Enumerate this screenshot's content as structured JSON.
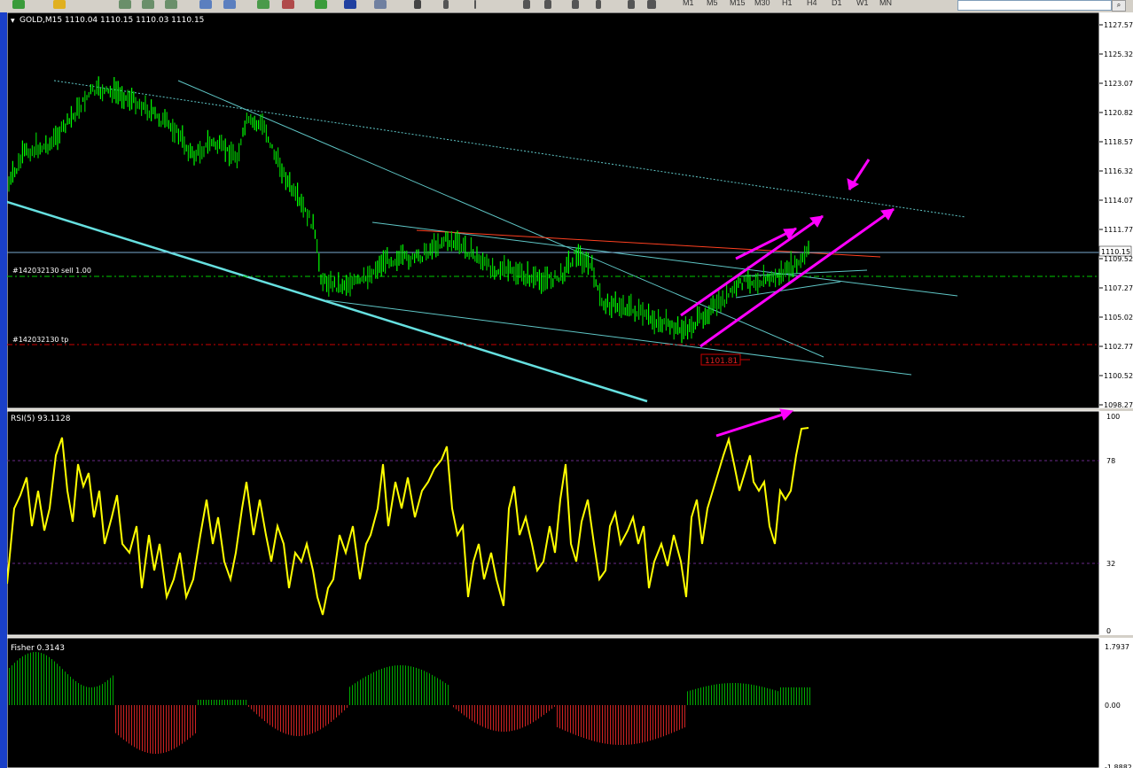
{
  "toolbar": {
    "timeframes": [
      "M1",
      "M5",
      "M15",
      "M30",
      "H1",
      "H4",
      "D1",
      "W1",
      "MN"
    ],
    "active_timeframe": "M15"
  },
  "price_chart": {
    "header": "GOLD,M15  1110.04 1110.15 1110.03 1110.15",
    "price_axis_ticks": [
      "1127.57",
      "1125.32",
      "1123.07",
      "1120.82",
      "1118.57",
      "1116.32",
      "1114.07",
      "1111.77",
      "1109.52",
      "1107.27",
      "1105.02",
      "1102.77",
      "1100.52",
      "1098.27"
    ],
    "current_price": "1110.15",
    "order_sell_label": "#142032130 sell 1.00",
    "order_tp_label": "#142032130 tp",
    "low_marker": "1101.81",
    "colors": {
      "background": "#000000",
      "bull": "#00ff00",
      "trendline": "#5fc6c6",
      "annotation": "#ff00ff",
      "sell_line": "#00cc00",
      "tp_line": "#cc0000"
    }
  },
  "rsi_panel": {
    "header": "RSI(5) 93.1128",
    "axis_ticks": [
      "100",
      "78",
      "32",
      "0"
    ],
    "line_color": "#ffff00"
  },
  "fisher_panel": {
    "header": "Fisher 0.3143",
    "axis_ticks": [
      "1.7937",
      "0.00",
      "-1.8882"
    ],
    "pos_color": "#00aa00",
    "neg_color": "#cc2222"
  }
}
